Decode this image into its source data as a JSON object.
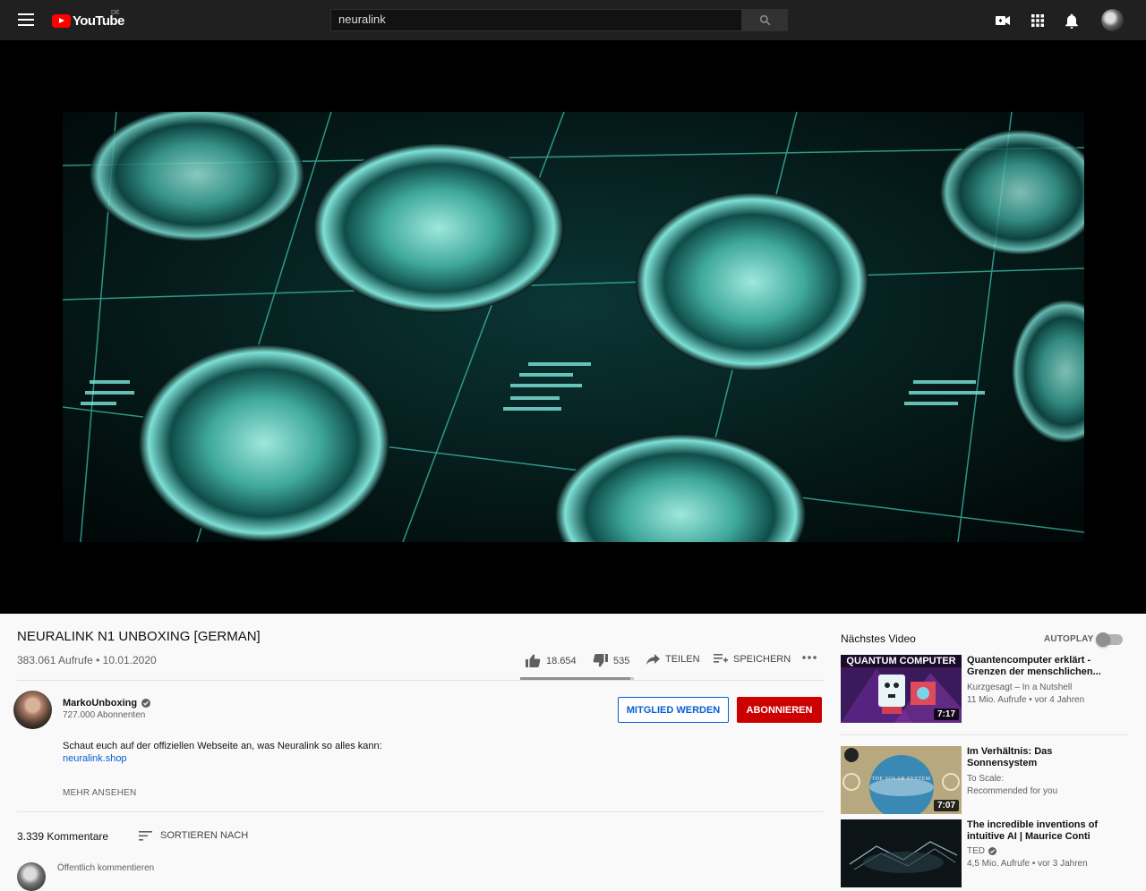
{
  "header": {
    "logo_text": "YouTube",
    "country": "DE",
    "search_value": "neuralink"
  },
  "video": {
    "title": "NEURALINK N1 UNBOXING [GERMAN]",
    "views": "383.061 Aufrufe",
    "date": "10.01.2020",
    "likes": "18.654",
    "dislikes": "535",
    "like_ratio": 0.97,
    "share_label": "TEILEN",
    "save_label": "SPEICHERN"
  },
  "channel": {
    "name": "MarkoUnboxing",
    "subscribers": "727.000 Abonnenten",
    "member_label": "MITGLIED WERDEN",
    "subscribe_label": "ABONNIEREN"
  },
  "description": {
    "text": "Schaut euch auf der offiziellen Webseite an, was Neuralink so alles kann:",
    "link": "neuralink.shop",
    "more_label": "MEHR ANSEHEN"
  },
  "comments": {
    "count": "3.339 Kommentare",
    "sort_label": "SORTIEREN NACH",
    "placeholder": "Öffentlich kommentieren"
  },
  "sidebar": {
    "next_label": "Nächstes Video",
    "autoplay_label": "AUTOPLAY",
    "autoplay_on": false,
    "items": [
      {
        "title": "Quantencomputer erklärt - Grenzen der menschlichen...",
        "channel": "Kurzgesagt – In a Nutshell",
        "views": "11 Mio. Aufrufe • vor 4 Jahren",
        "duration": "7:17",
        "thumb_text": "QUANTUM COMPUTER"
      },
      {
        "title": "Im Verhältnis: Das Sonnensystem",
        "channel": "To Scale:",
        "views": "Recommended for you",
        "duration": "7:07",
        "thumb_text": "THE SOLAR SYSTEM"
      },
      {
        "title": "The incredible inventions of intuitive AI | Maurice Conti",
        "channel": "TED",
        "views": "4,5 Mio. Aufrufe • vor 3 Jahren",
        "duration": ""
      }
    ]
  },
  "colors": {
    "subscribe": "#cc0000",
    "link": "#065fd4",
    "header_bg": "#202020"
  }
}
